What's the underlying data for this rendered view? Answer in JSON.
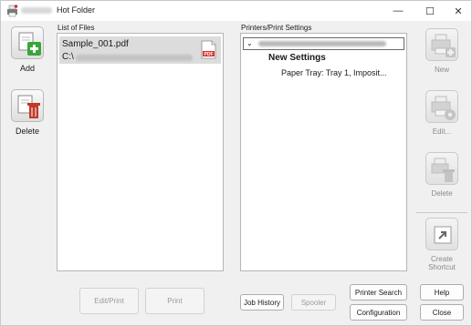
{
  "window": {
    "title": "Hot Folder",
    "controls": {
      "minimize": "—",
      "maximize": "☐",
      "close": "✕"
    }
  },
  "left_toolbar": {
    "add_label": "Add",
    "delete_label": "Delete"
  },
  "files_panel": {
    "label": "List of Files",
    "items": [
      {
        "name": "Sample_001.pdf",
        "path_prefix": "C:\\",
        "icon": "pdf-file-icon",
        "icon_text": "PDF"
      }
    ]
  },
  "printers_panel": {
    "label": "Printers/Print Settings",
    "tree_toggle": "⌄",
    "settings_name": "New Settings",
    "tray_text": "Paper Tray: Tray 1, Imposit..."
  },
  "right_toolbar": {
    "new_label": "New",
    "edit_label": "Edit...",
    "delete_label": "Delete",
    "shortcut_label": "Create Shortcut",
    "shortcut_enabled": true
  },
  "buttons": {
    "edit_print": "Edit/Print",
    "print": "Print",
    "job_history": "Job History",
    "spooler": "Spooler",
    "printer_search": "Printer Search",
    "configuration": "Configuration",
    "help": "Help",
    "close": "Close"
  },
  "colors": {
    "add_accent": "#3aa53a",
    "delete_accent": "#c0392b",
    "pdf_red": "#d6332b",
    "selection": "#dcdcdc"
  }
}
